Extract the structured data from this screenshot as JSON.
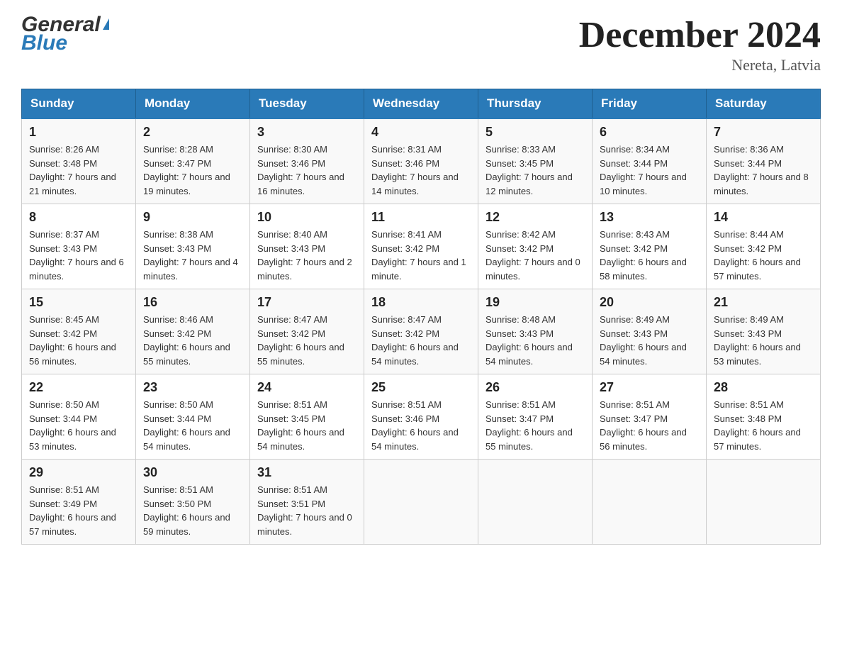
{
  "header": {
    "logo_general": "General",
    "logo_blue": "Blue",
    "month_title": "December 2024",
    "location": "Nereta, Latvia"
  },
  "days_of_week": [
    "Sunday",
    "Monday",
    "Tuesday",
    "Wednesday",
    "Thursday",
    "Friday",
    "Saturday"
  ],
  "weeks": [
    [
      {
        "day": "1",
        "sunrise": "8:26 AM",
        "sunset": "3:48 PM",
        "daylight": "7 hours and 21 minutes."
      },
      {
        "day": "2",
        "sunrise": "8:28 AM",
        "sunset": "3:47 PM",
        "daylight": "7 hours and 19 minutes."
      },
      {
        "day": "3",
        "sunrise": "8:30 AM",
        "sunset": "3:46 PM",
        "daylight": "7 hours and 16 minutes."
      },
      {
        "day": "4",
        "sunrise": "8:31 AM",
        "sunset": "3:46 PM",
        "daylight": "7 hours and 14 minutes."
      },
      {
        "day": "5",
        "sunrise": "8:33 AM",
        "sunset": "3:45 PM",
        "daylight": "7 hours and 12 minutes."
      },
      {
        "day": "6",
        "sunrise": "8:34 AM",
        "sunset": "3:44 PM",
        "daylight": "7 hours and 10 minutes."
      },
      {
        "day": "7",
        "sunrise": "8:36 AM",
        "sunset": "3:44 PM",
        "daylight": "7 hours and 8 minutes."
      }
    ],
    [
      {
        "day": "8",
        "sunrise": "8:37 AM",
        "sunset": "3:43 PM",
        "daylight": "7 hours and 6 minutes."
      },
      {
        "day": "9",
        "sunrise": "8:38 AM",
        "sunset": "3:43 PM",
        "daylight": "7 hours and 4 minutes."
      },
      {
        "day": "10",
        "sunrise": "8:40 AM",
        "sunset": "3:43 PM",
        "daylight": "7 hours and 2 minutes."
      },
      {
        "day": "11",
        "sunrise": "8:41 AM",
        "sunset": "3:42 PM",
        "daylight": "7 hours and 1 minute."
      },
      {
        "day": "12",
        "sunrise": "8:42 AM",
        "sunset": "3:42 PM",
        "daylight": "7 hours and 0 minutes."
      },
      {
        "day": "13",
        "sunrise": "8:43 AM",
        "sunset": "3:42 PM",
        "daylight": "6 hours and 58 minutes."
      },
      {
        "day": "14",
        "sunrise": "8:44 AM",
        "sunset": "3:42 PM",
        "daylight": "6 hours and 57 minutes."
      }
    ],
    [
      {
        "day": "15",
        "sunrise": "8:45 AM",
        "sunset": "3:42 PM",
        "daylight": "6 hours and 56 minutes."
      },
      {
        "day": "16",
        "sunrise": "8:46 AM",
        "sunset": "3:42 PM",
        "daylight": "6 hours and 55 minutes."
      },
      {
        "day": "17",
        "sunrise": "8:47 AM",
        "sunset": "3:42 PM",
        "daylight": "6 hours and 55 minutes."
      },
      {
        "day": "18",
        "sunrise": "8:47 AM",
        "sunset": "3:42 PM",
        "daylight": "6 hours and 54 minutes."
      },
      {
        "day": "19",
        "sunrise": "8:48 AM",
        "sunset": "3:43 PM",
        "daylight": "6 hours and 54 minutes."
      },
      {
        "day": "20",
        "sunrise": "8:49 AM",
        "sunset": "3:43 PM",
        "daylight": "6 hours and 54 minutes."
      },
      {
        "day": "21",
        "sunrise": "8:49 AM",
        "sunset": "3:43 PM",
        "daylight": "6 hours and 53 minutes."
      }
    ],
    [
      {
        "day": "22",
        "sunrise": "8:50 AM",
        "sunset": "3:44 PM",
        "daylight": "6 hours and 53 minutes."
      },
      {
        "day": "23",
        "sunrise": "8:50 AM",
        "sunset": "3:44 PM",
        "daylight": "6 hours and 54 minutes."
      },
      {
        "day": "24",
        "sunrise": "8:51 AM",
        "sunset": "3:45 PM",
        "daylight": "6 hours and 54 minutes."
      },
      {
        "day": "25",
        "sunrise": "8:51 AM",
        "sunset": "3:46 PM",
        "daylight": "6 hours and 54 minutes."
      },
      {
        "day": "26",
        "sunrise": "8:51 AM",
        "sunset": "3:47 PM",
        "daylight": "6 hours and 55 minutes."
      },
      {
        "day": "27",
        "sunrise": "8:51 AM",
        "sunset": "3:47 PM",
        "daylight": "6 hours and 56 minutes."
      },
      {
        "day": "28",
        "sunrise": "8:51 AM",
        "sunset": "3:48 PM",
        "daylight": "6 hours and 57 minutes."
      }
    ],
    [
      {
        "day": "29",
        "sunrise": "8:51 AM",
        "sunset": "3:49 PM",
        "daylight": "6 hours and 57 minutes."
      },
      {
        "day": "30",
        "sunrise": "8:51 AM",
        "sunset": "3:50 PM",
        "daylight": "6 hours and 59 minutes."
      },
      {
        "day": "31",
        "sunrise": "8:51 AM",
        "sunset": "3:51 PM",
        "daylight": "7 hours and 0 minutes."
      },
      null,
      null,
      null,
      null
    ]
  ]
}
